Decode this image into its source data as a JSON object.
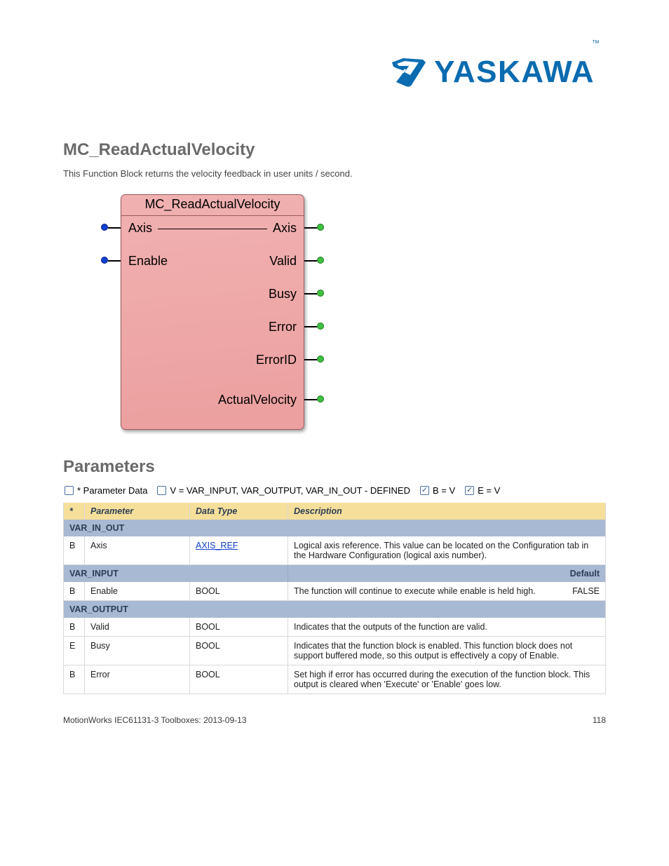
{
  "logo": {
    "text": "YASKAWA"
  },
  "headings": {
    "h1": "MC_ReadActualVelocity",
    "h2": "Parameters"
  },
  "description": "This Function Block returns the velocity feedback in user units / second.",
  "fb": {
    "title": "MC_ReadActualVelocity",
    "inputs": [
      "Axis",
      "Enable"
    ],
    "outputs": [
      "Axis",
      "Valid",
      "Busy",
      "Error",
      "ErrorID",
      "ActualVelocity"
    ]
  },
  "tableHeaders": {
    "c1": "Parameter",
    "c2": "Data Type",
    "c3": "Description"
  },
  "sections": {
    "varinout": "VAR_IN_OUT",
    "varin": "VAR_INPUT",
    "varout": "VAR_OUTPUT",
    "default": "Default"
  },
  "rows": {
    "axis": {
      "v": "B",
      "p": "Axis",
      "t": "AXIS_REF",
      "d": "Logical axis reference.  This value can be located on the Configuration tab in the Hardware Configuration (logical axis number)."
    },
    "enable": {
      "v": "B",
      "p": "Enable",
      "t": "BOOL",
      "d": "The function will continue to execute while enable is held high.",
      "def": "FALSE"
    },
    "valid": {
      "v": "B",
      "p": "Valid",
      "t": "BOOL",
      "d": "Indicates that the outputs of the function are valid."
    },
    "busy": {
      "v": "E",
      "p": "Busy",
      "t": "BOOL",
      "d": "Indicates that the function block is enabled.  This function block does not support buffered mode, so this output is effectively a copy of Enable."
    },
    "error": {
      "v": "B",
      "p": "Error",
      "t": "BOOL",
      "d": "Set high if error has occurred during the execution of the function block.  This output is cleared when 'Execute' or 'Enable' goes low."
    }
  },
  "legend": {
    "items": [
      {
        "label": "*",
        "caption": " Parameter Data",
        "checked": false
      },
      {
        "label": "V",
        "caption": " = VAR_INPUT, VAR_OUTPUT, VAR_IN_OUT - DEFINED",
        "checked": false
      },
      {
        "label": "B",
        "caption": " = V",
        "checked": true
      },
      {
        "label": "E",
        "caption": " = V",
        "checked": true
      }
    ]
  },
  "footer": {
    "left": "MotionWorks IEC61131-3 Toolboxes: 2013-09-13",
    "right": "118"
  }
}
